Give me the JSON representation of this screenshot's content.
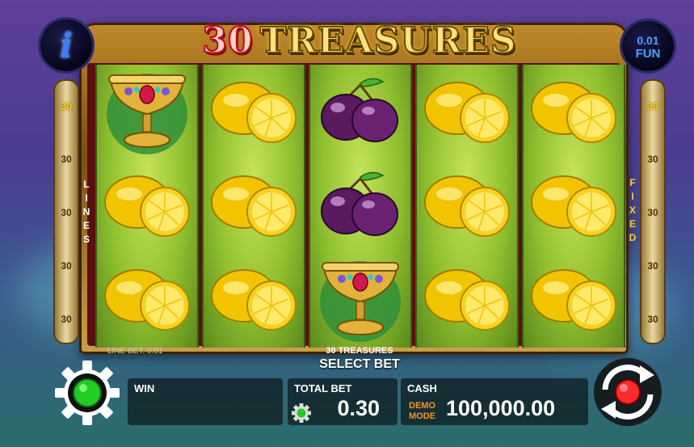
{
  "game": {
    "title_number": "30",
    "title_word": "TREASURES",
    "name": "30 TREASURES",
    "select_bet": "SELECT BET"
  },
  "info_button": {
    "icon": "info-icon",
    "label": "i"
  },
  "fun_display": {
    "amount": "0.01",
    "mode": "FUN"
  },
  "left_panel": {
    "label_letters": [
      "L",
      "I",
      "N",
      "E",
      "S"
    ],
    "numbers": [
      "30",
      "30",
      "30",
      "30",
      "30"
    ],
    "active_index": 0
  },
  "right_panel": {
    "label_letters": [
      "F",
      "I",
      "X",
      "E",
      "D"
    ],
    "numbers": [
      "30",
      "30",
      "30",
      "30",
      "30"
    ],
    "active_index": 0
  },
  "reels": [
    [
      "goblet",
      "lemon",
      "lemon"
    ],
    [
      "lemon",
      "lemon",
      "lemon"
    ],
    [
      "plum",
      "plum",
      "goblet"
    ],
    [
      "lemon",
      "lemon",
      "lemon"
    ],
    [
      "lemon",
      "lemon",
      "lemon"
    ]
  ],
  "line_bet": "LINE BET: 0.01",
  "win": {
    "label": "WIN",
    "value": ""
  },
  "total_bet": {
    "label": "TOTAL BET",
    "value": "0.30"
  },
  "cash": {
    "label": "CASH",
    "mode_line1": "DEMO",
    "mode_line2": "MODE",
    "value": "100,000.00"
  },
  "colors": {
    "active_side_number": "#f6d21c",
    "gear_light": "#22cc22",
    "spin_light": "#ff2a2a",
    "demo_text": "#f0962a",
    "fun_text": "#4aa3ff"
  }
}
